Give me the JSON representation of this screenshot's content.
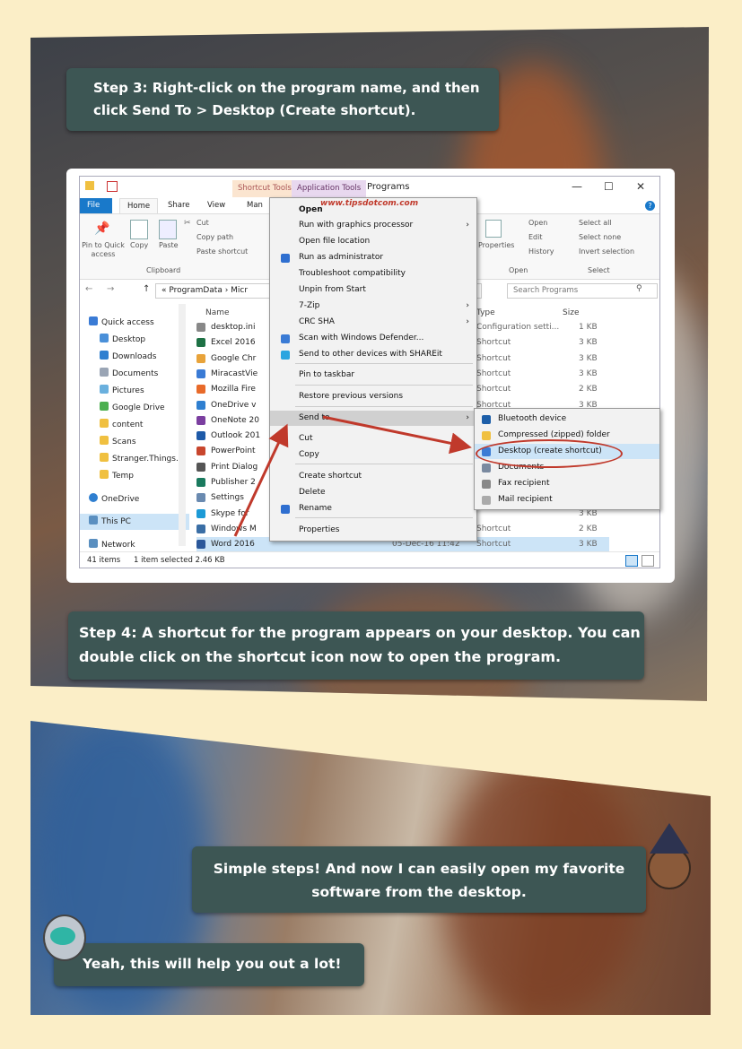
{
  "page": {
    "step3_label": "Step 3",
    "step3_text": ": Right-click on the program name, and then click Send To > Desktop (Create shortcut).",
    "step4_label": "Step 4",
    "step4_text": ": A shortcut for the program appears on your desktop. You can double click on the shortcut icon now to open the program.",
    "speech1": "Simple steps! And now I can easily open my favorite software from the desktop.",
    "speech2": "Yeah, this will help you out a lot!"
  },
  "explorer": {
    "title": "Programs",
    "context_tabs": [
      "Shortcut Tools",
      "Application Tools"
    ],
    "tabs": [
      "File",
      "Home",
      "Share",
      "View",
      "Man"
    ],
    "ribbon": {
      "pin_label": "Pin to Quick access",
      "copy": "Copy",
      "paste": "Paste",
      "cut": "Cut",
      "copy_path": "Copy path",
      "paste_shortcut": "Paste shortcut",
      "clipboard_group": "Clipboard",
      "properties": "Properties",
      "open": "Open",
      "edit": "Edit",
      "history": "History",
      "open_group": "Open",
      "select_all": "Select all",
      "select_none": "Select none",
      "invert_selection": "Invert selection",
      "select_group": "Select"
    },
    "address": "« ProgramData › Micr",
    "search_placeholder": "Search Programs",
    "nav": [
      {
        "label": "Quick access",
        "icon": "star-icon"
      },
      {
        "label": "Desktop",
        "icon": "folder-icon"
      },
      {
        "label": "Downloads",
        "icon": "download-icon"
      },
      {
        "label": "Documents",
        "icon": "folder-icon"
      },
      {
        "label": "Pictures",
        "icon": "folder-icon"
      },
      {
        "label": "Google Drive",
        "icon": "folder-icon"
      },
      {
        "label": "content",
        "icon": "folder-icon"
      },
      {
        "label": "Scans",
        "icon": "folder-icon"
      },
      {
        "label": "Stranger.Things.S",
        "icon": "folder-icon"
      },
      {
        "label": "Temp",
        "icon": "folder-icon"
      },
      {
        "label": "OneDrive",
        "icon": "cloud-icon"
      },
      {
        "label": "This PC",
        "icon": "computer-icon"
      },
      {
        "label": "Network",
        "icon": "network-icon"
      }
    ],
    "columns": {
      "name": "Name",
      "type": "Type",
      "size": "Size"
    },
    "files": [
      {
        "name": "desktop.ini",
        "type": "Configuration setti...",
        "size": "1 KB"
      },
      {
        "name": "Excel 2016",
        "type": "Shortcut",
        "size": "3 KB"
      },
      {
        "name": "Google Chr",
        "type": "Shortcut",
        "size": "3 KB"
      },
      {
        "name": "MiracastVie",
        "type": "Shortcut",
        "size": "3 KB"
      },
      {
        "name": "Mozilla Fire",
        "type": "Shortcut",
        "size": "2 KB"
      },
      {
        "name": "OneDrive v",
        "type": "Shortcut",
        "size": "3 KB"
      },
      {
        "name": "OneNote 20",
        "type": "",
        "size": ""
      },
      {
        "name": "Outlook 201",
        "type": "",
        "size": ""
      },
      {
        "name": "PowerPoint",
        "type": "",
        "size": ""
      },
      {
        "name": "Print Dialog",
        "type": "",
        "size": ""
      },
      {
        "name": "Publisher 2",
        "type": "",
        "size": ""
      },
      {
        "name": "Settings",
        "type": "",
        "size": ""
      },
      {
        "name": "Skype for",
        "type": "",
        "size": "3 KB"
      },
      {
        "name": "Windows M",
        "type": "Shortcut",
        "size": "2 KB"
      },
      {
        "name": "Word 2016",
        "date": "05-Dec-16 11:42",
        "type": "Shortcut",
        "size": "3 KB"
      }
    ],
    "status": {
      "count": "41 items",
      "selected": "1 item selected  2.46 KB"
    }
  },
  "context_menu": {
    "watermark": "www.tipsdotcom.com",
    "items": [
      {
        "label": "Open",
        "bold": true
      },
      {
        "label": "Run with graphics processor",
        "submenu": true
      },
      {
        "label": "Open file location"
      },
      {
        "label": "Run as administrator",
        "icon": "shield-icon"
      },
      {
        "label": "Troubleshoot compatibility"
      },
      {
        "label": "Unpin from Start"
      },
      {
        "label": "7-Zip",
        "submenu": true
      },
      {
        "label": "CRC SHA",
        "submenu": true
      },
      {
        "label": "Scan with Windows Defender...",
        "icon": "defender-icon"
      },
      {
        "label": "Send to other devices with SHAREit",
        "icon": "shareit-icon"
      },
      {
        "label": "Pin to taskbar"
      },
      {
        "label": "Restore previous versions"
      },
      {
        "label": "Send to",
        "submenu": true
      },
      {
        "label": "Cut"
      },
      {
        "label": "Copy"
      },
      {
        "label": "Create shortcut"
      },
      {
        "label": "Delete"
      },
      {
        "label": "Rename",
        "icon": "shield-icon"
      },
      {
        "label": "Properties"
      }
    ]
  },
  "sendto_menu": {
    "items": [
      {
        "label": "Bluetooth device",
        "icon": "bluetooth-icon"
      },
      {
        "label": "Compressed (zipped) folder",
        "icon": "zip-folder-icon"
      },
      {
        "label": "Desktop (create shortcut)",
        "icon": "desktop-icon"
      },
      {
        "label": "Documents",
        "icon": "documents-icon"
      },
      {
        "label": "Fax recipient",
        "icon": "fax-icon"
      },
      {
        "label": "Mail recipient",
        "icon": "mail-icon"
      }
    ]
  },
  "colors": {
    "caption_bg": "#3d5654",
    "arrow": "#c0392b",
    "page_bg": "#fbeec7"
  }
}
